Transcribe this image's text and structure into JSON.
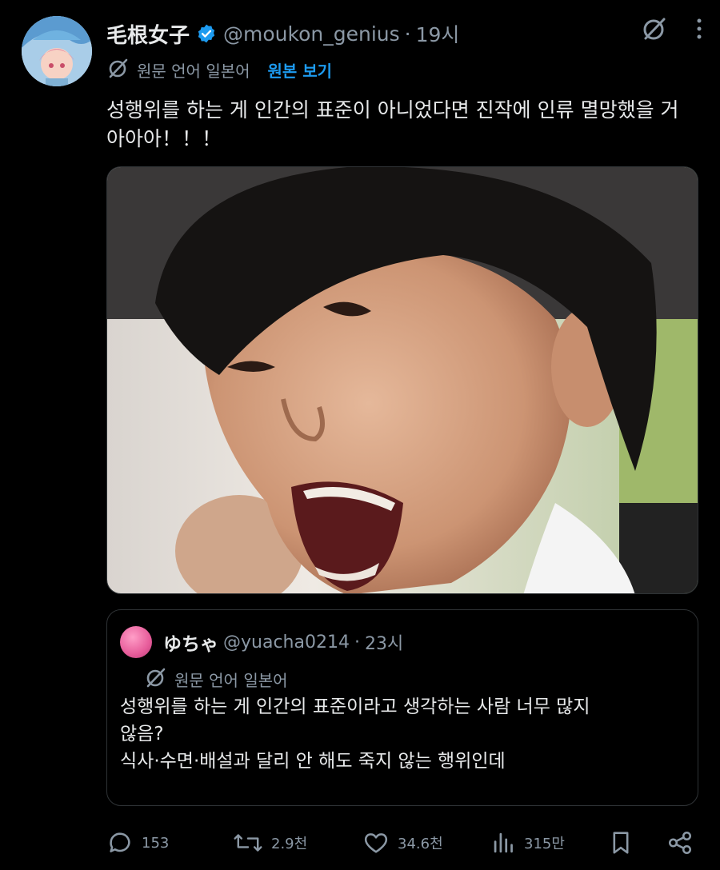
{
  "tweet": {
    "display_name": "毛根女子",
    "handle": "@moukon_genius",
    "separator": "·",
    "time": "19시",
    "translation": {
      "label": "원문 언어 일본어",
      "show_original": "원본 보기"
    },
    "text_lines": [
      "성행위를 하는 게 인간의 표준이 아니었다면 진작에 인류 멸망했을 거",
      "아아아！！！"
    ]
  },
  "quote": {
    "display_name": "ゆちゃ",
    "handle": "@yuacha0214",
    "separator": "·",
    "time": "23시",
    "translation": {
      "label": "원문 언어 일본어"
    },
    "text_lines": [
      "성행위를 하는 게 인간의 표준이라고 생각하는 사람 너무 많지",
      "않음?",
      "식사·수면·배설과 달리 안 해도 죽지 않는 행위인데"
    ]
  },
  "actions": {
    "replies": "153",
    "reposts": "2.9천",
    "likes": "34.6천",
    "views": "315만"
  },
  "colors": {
    "accent": "#1d9bf0",
    "muted": "#8b98a5",
    "text": "#e7e9ea",
    "background": "#000000",
    "border": "#2f3336"
  },
  "icons": [
    "grok-icon",
    "more-icon",
    "verified-badge-icon",
    "translate-icon",
    "reply-icon",
    "repost-icon",
    "like-icon",
    "views-icon",
    "bookmark-icon",
    "share-icon"
  ]
}
